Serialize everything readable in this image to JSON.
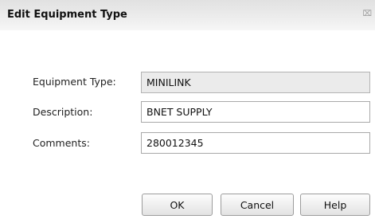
{
  "dialog": {
    "title": "Edit Equipment Type",
    "close_symbol": "⌧"
  },
  "form": {
    "equipment_type": {
      "label": "Equipment Type:",
      "value": "MINILINK"
    },
    "description": {
      "label": "Description:",
      "value": "BNET SUPPLY"
    },
    "comments": {
      "label": "Comments:",
      "value": "280012345"
    }
  },
  "buttons": {
    "ok": "OK",
    "cancel": "Cancel",
    "help": "Help"
  },
  "icons": {
    "close": "close-icon"
  }
}
